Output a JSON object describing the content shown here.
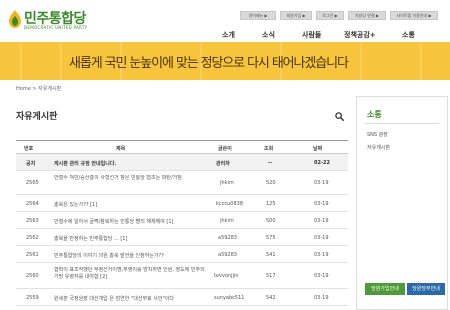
{
  "logo": {
    "text": "민주통합당",
    "sub": "DEMOCRATIC UNITED PARTY"
  },
  "top_menu": [
    {
      "label": "영어메뉴 ▶"
    },
    {
      "label": "회원가입 ▶"
    },
    {
      "label": "로그인 ▶"
    },
    {
      "label": "지방당 연결 ▶"
    },
    {
      "label": "사이트맵 이용안내 ▶"
    }
  ],
  "gnb": [
    {
      "label": "소개"
    },
    {
      "label": "소식"
    },
    {
      "label": "사람들"
    },
    {
      "label": "정책공감+"
    },
    {
      "label": "소통"
    }
  ],
  "banner": {
    "text": "새롭게 국민 눈높이에 맞는 정당으로 다시 태어나겠습니다"
  },
  "breadcrumb": "Home > 자유게시판",
  "board": {
    "title": "자유게시판",
    "columns": [
      "번호",
      "제목",
      "글쓴이",
      "조회",
      "날짜"
    ],
    "rows": [
      {
        "no": "공지",
        "title": "게시판 관리 규정 안내입니다.",
        "author": "관리자",
        "views": "--",
        "date": "02-22",
        "notice": true
      },
      {
        "no": "2565",
        "title": "안철수 쳐민/중산층의 사형선거 항은 민통당 협조는 파탄/거짐",
        "author": "jhkim",
        "views": "520",
        "date": "03-19"
      },
      {
        "no": "2564",
        "title": "총북은 있는가?? [1]",
        "author": "kcccu0838",
        "views": "125",
        "date": "03-19"
      },
      {
        "no": "2563",
        "title": "안철수에 일어서 글쩍/참북하는 민통당 빨리 해체해야 [1]",
        "author": "jhkim",
        "views": "500",
        "date": "03-19"
      },
      {
        "no": "2562",
        "title": "총북을 만정하는 민주통합당 ... [1]",
        "author": "a59283",
        "views": "575",
        "date": "03-19"
      },
      {
        "no": "2561",
        "title": "민주통합당의 이야기 의원 총북 발언을 인정하는가??",
        "author": "a59283",
        "views": "541",
        "date": "03-19"
      },
      {
        "no": "2560",
        "title": "협력이 표조작했던 부정선거이명,무영이를 방치하면 인원, 영도에 민주의 가망 유령자를 내야함 [2]",
        "author": "tevvonjjin",
        "views": "517",
        "date": "03-19"
      },
      {
        "no": "2559",
        "title": "원세훈 국정원장 대선개입 은 엄연한 \"대선무효 사안\"이다",
        "author": "sunyabc511",
        "views": "542",
        "date": "03-19"
      }
    ]
  },
  "sidebar": {
    "title": "소통",
    "items": [
      "SNS 광장",
      "자유게시판"
    ],
    "join_button": "당원가입안내",
    "inquiry_button": "당원당부안내"
  },
  "colors": {
    "accent_green": "#3a8a2a",
    "banner": "#f6c53b",
    "button_green": "#4d9a3a",
    "button_blue": "#2b6aa8"
  }
}
